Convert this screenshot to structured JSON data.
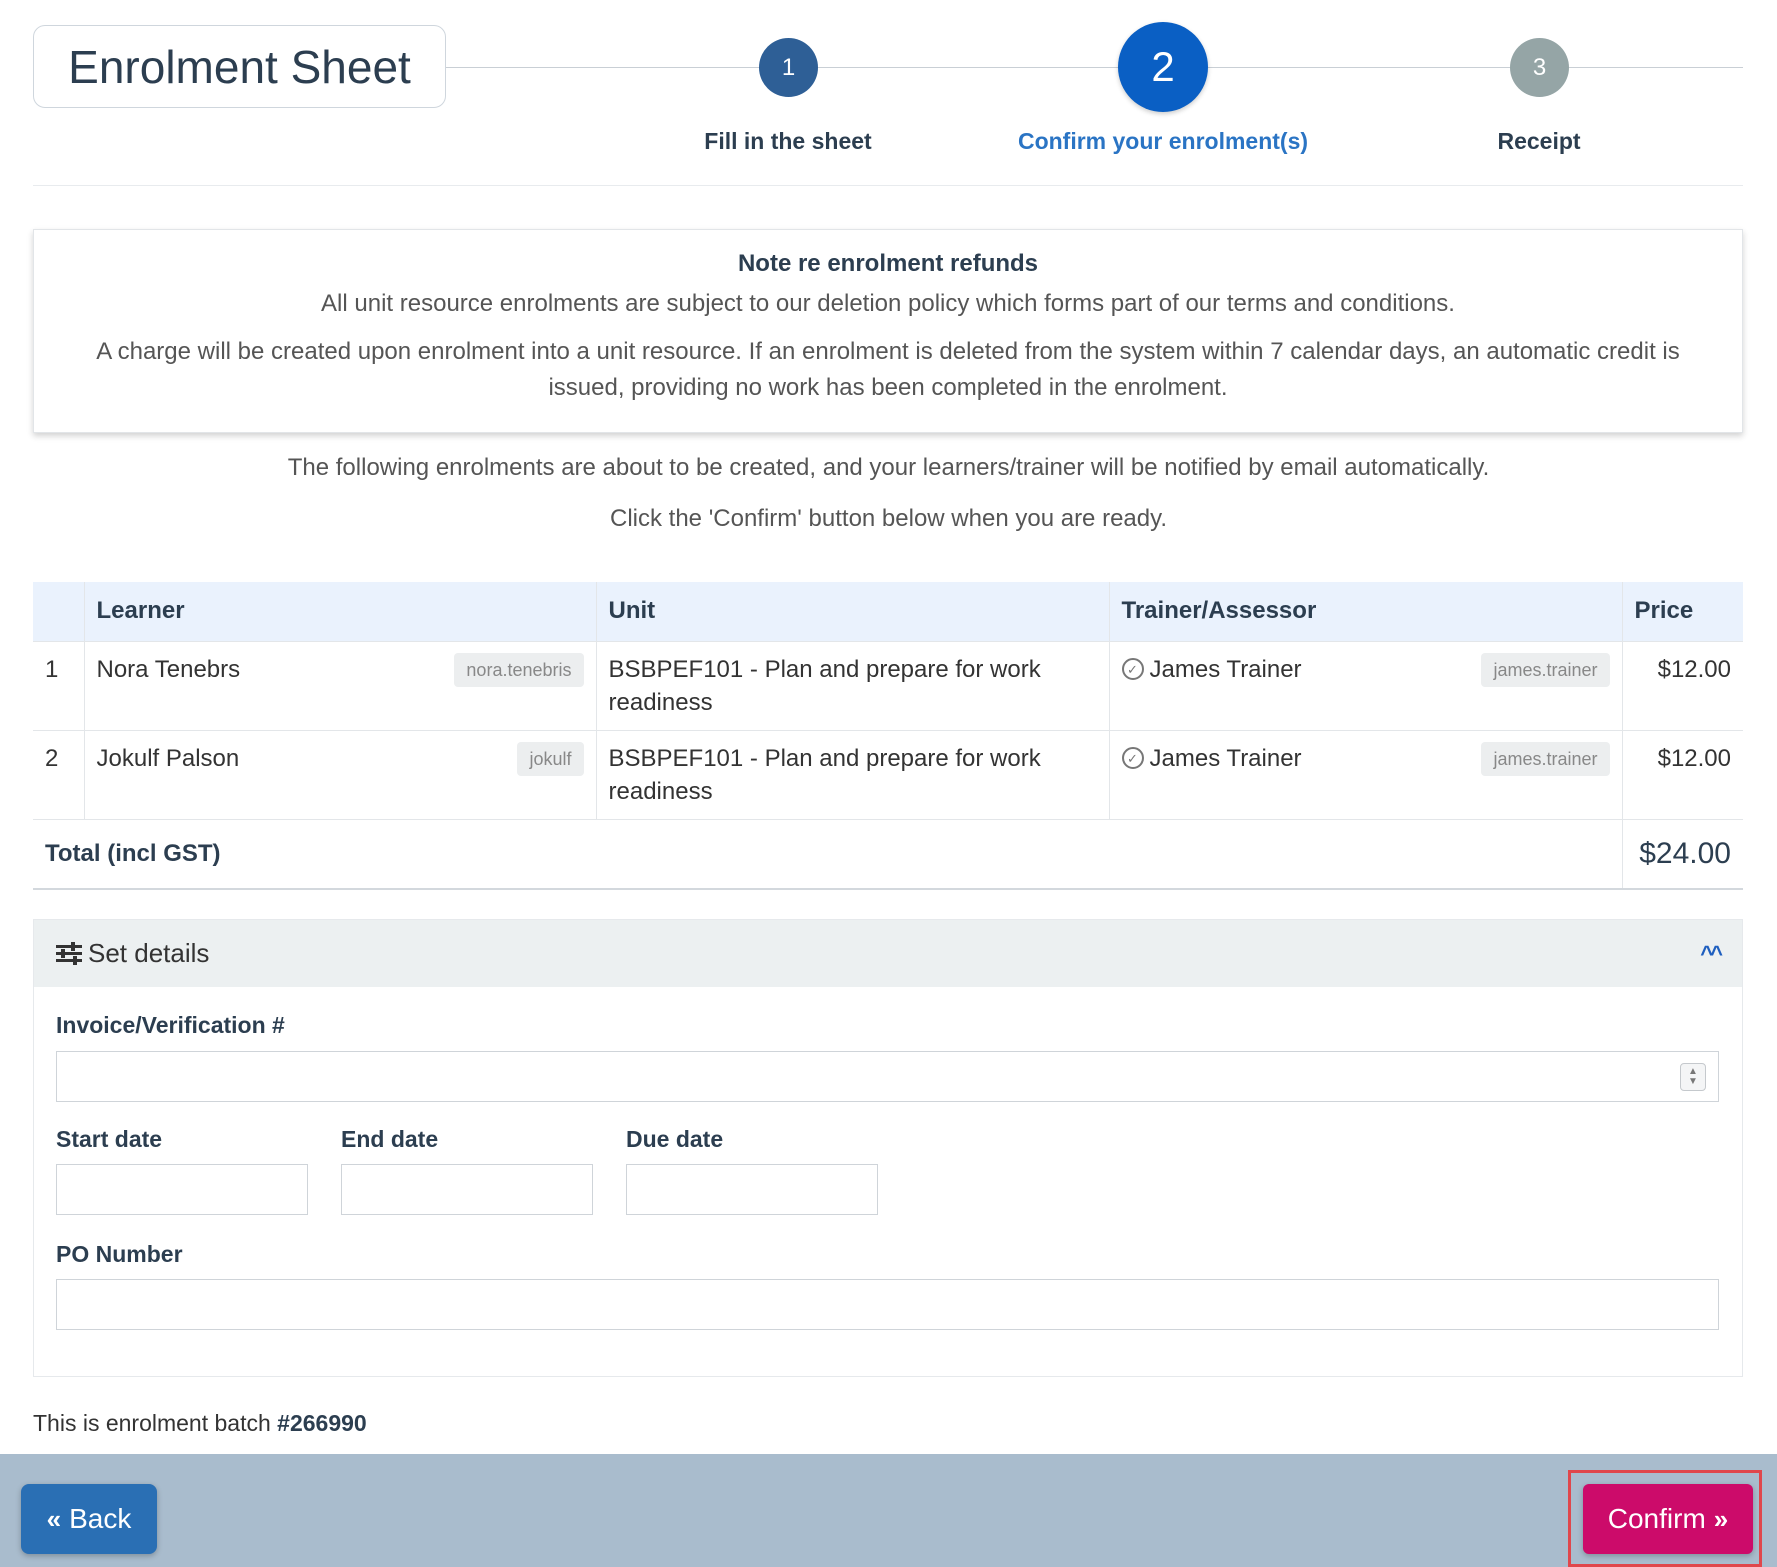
{
  "header": {
    "title": "Enrolment Sheet",
    "steps": [
      {
        "number": "1",
        "label": "Fill in the sheet",
        "state": "done"
      },
      {
        "number": "2",
        "label": "Confirm your enrolment(s)",
        "state": "active"
      },
      {
        "number": "3",
        "label": "Receipt",
        "state": "pending"
      }
    ]
  },
  "note": {
    "heading": "Note re enrolment refunds",
    "line1": "All unit resource enrolments are subject to our deletion policy which forms part of our terms and conditions.",
    "line2": "A charge will be created upon enrolment into a unit resource. If an enrolment is deleted from the system within 7 calendar days, an automatic credit is issued, providing no work has been completed in the enrolment."
  },
  "intro": {
    "line1": "The following enrolments are about to be created, and your learners/trainer will be notified by email automatically.",
    "line2": "Click the 'Confirm' button below when you are ready."
  },
  "table": {
    "headers": [
      "",
      "Learner",
      "Unit",
      "Trainer/Assessor",
      "Price"
    ],
    "rows": [
      {
        "num": "1",
        "learner": "Nora Tenebrs",
        "learner_user": "nora.tenebris",
        "unit": "BSBPEF101 - Plan and prepare for work readiness",
        "trainer": "James Trainer",
        "trainer_user": "james.trainer",
        "price": "$12.00"
      },
      {
        "num": "2",
        "learner": "Jokulf Palson",
        "learner_user": "jokulf",
        "unit": "BSBPEF101 - Plan and prepare for work readiness",
        "trainer": "James Trainer",
        "trainer_user": "james.trainer",
        "price": "$12.00"
      }
    ],
    "total_label": "Total (incl GST)",
    "total_value": "$24.00"
  },
  "details": {
    "title": "Set details",
    "icon": "sliders-icon",
    "collapse_icon": "chevron-up-icon",
    "invoice_label": "Invoice/Verification #",
    "invoice_value": "",
    "start_label": "Start date",
    "start_value": "",
    "end_label": "End date",
    "end_value": "",
    "due_label": "Due date",
    "due_value": "",
    "po_label": "PO Number",
    "po_value": ""
  },
  "batch": {
    "prefix": "This is enrolment batch",
    "number": "#266990"
  },
  "footer": {
    "back_label": "Back",
    "confirm_label": "Confirm"
  },
  "colors": {
    "step_done": "#2e5f96",
    "step_active": "#0a5fc4",
    "step_pending": "#95a5a6",
    "confirm": "#cc0b6a",
    "back": "#2a6fb4",
    "footer": "#a9bccd"
  }
}
